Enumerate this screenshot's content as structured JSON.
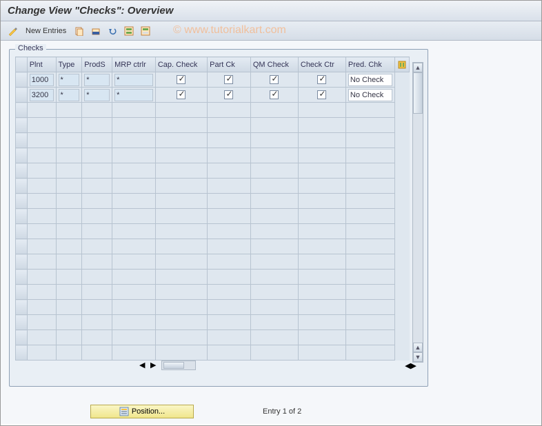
{
  "title": "Change View \"Checks\": Overview",
  "watermark": "© www.tutorialkart.com",
  "toolbar": {
    "new_entries": "New Entries"
  },
  "panel": {
    "title": "Checks",
    "columns": {
      "plnt": "Plnt",
      "type": "Type",
      "prods": "ProdS",
      "mrp": "MRP ctrlr",
      "cap": "Cap. Check",
      "part": "Part Ck",
      "qm": "QM Check",
      "ctr": "Check Ctr",
      "pred": "Pred. Chk"
    },
    "rows": [
      {
        "plnt": "1000",
        "type": "*",
        "prods": "*",
        "mrp": "*",
        "cap": true,
        "part": true,
        "qm": true,
        "ctr": true,
        "pred": "No Check"
      },
      {
        "plnt": "3200",
        "type": "*",
        "prods": "*",
        "mrp": "*",
        "cap": true,
        "part": true,
        "qm": true,
        "ctr": true,
        "pred": "No Check"
      }
    ],
    "empty_rows": 17
  },
  "footer": {
    "position_btn": "Position...",
    "entry_text": "Entry 1 of 2"
  }
}
